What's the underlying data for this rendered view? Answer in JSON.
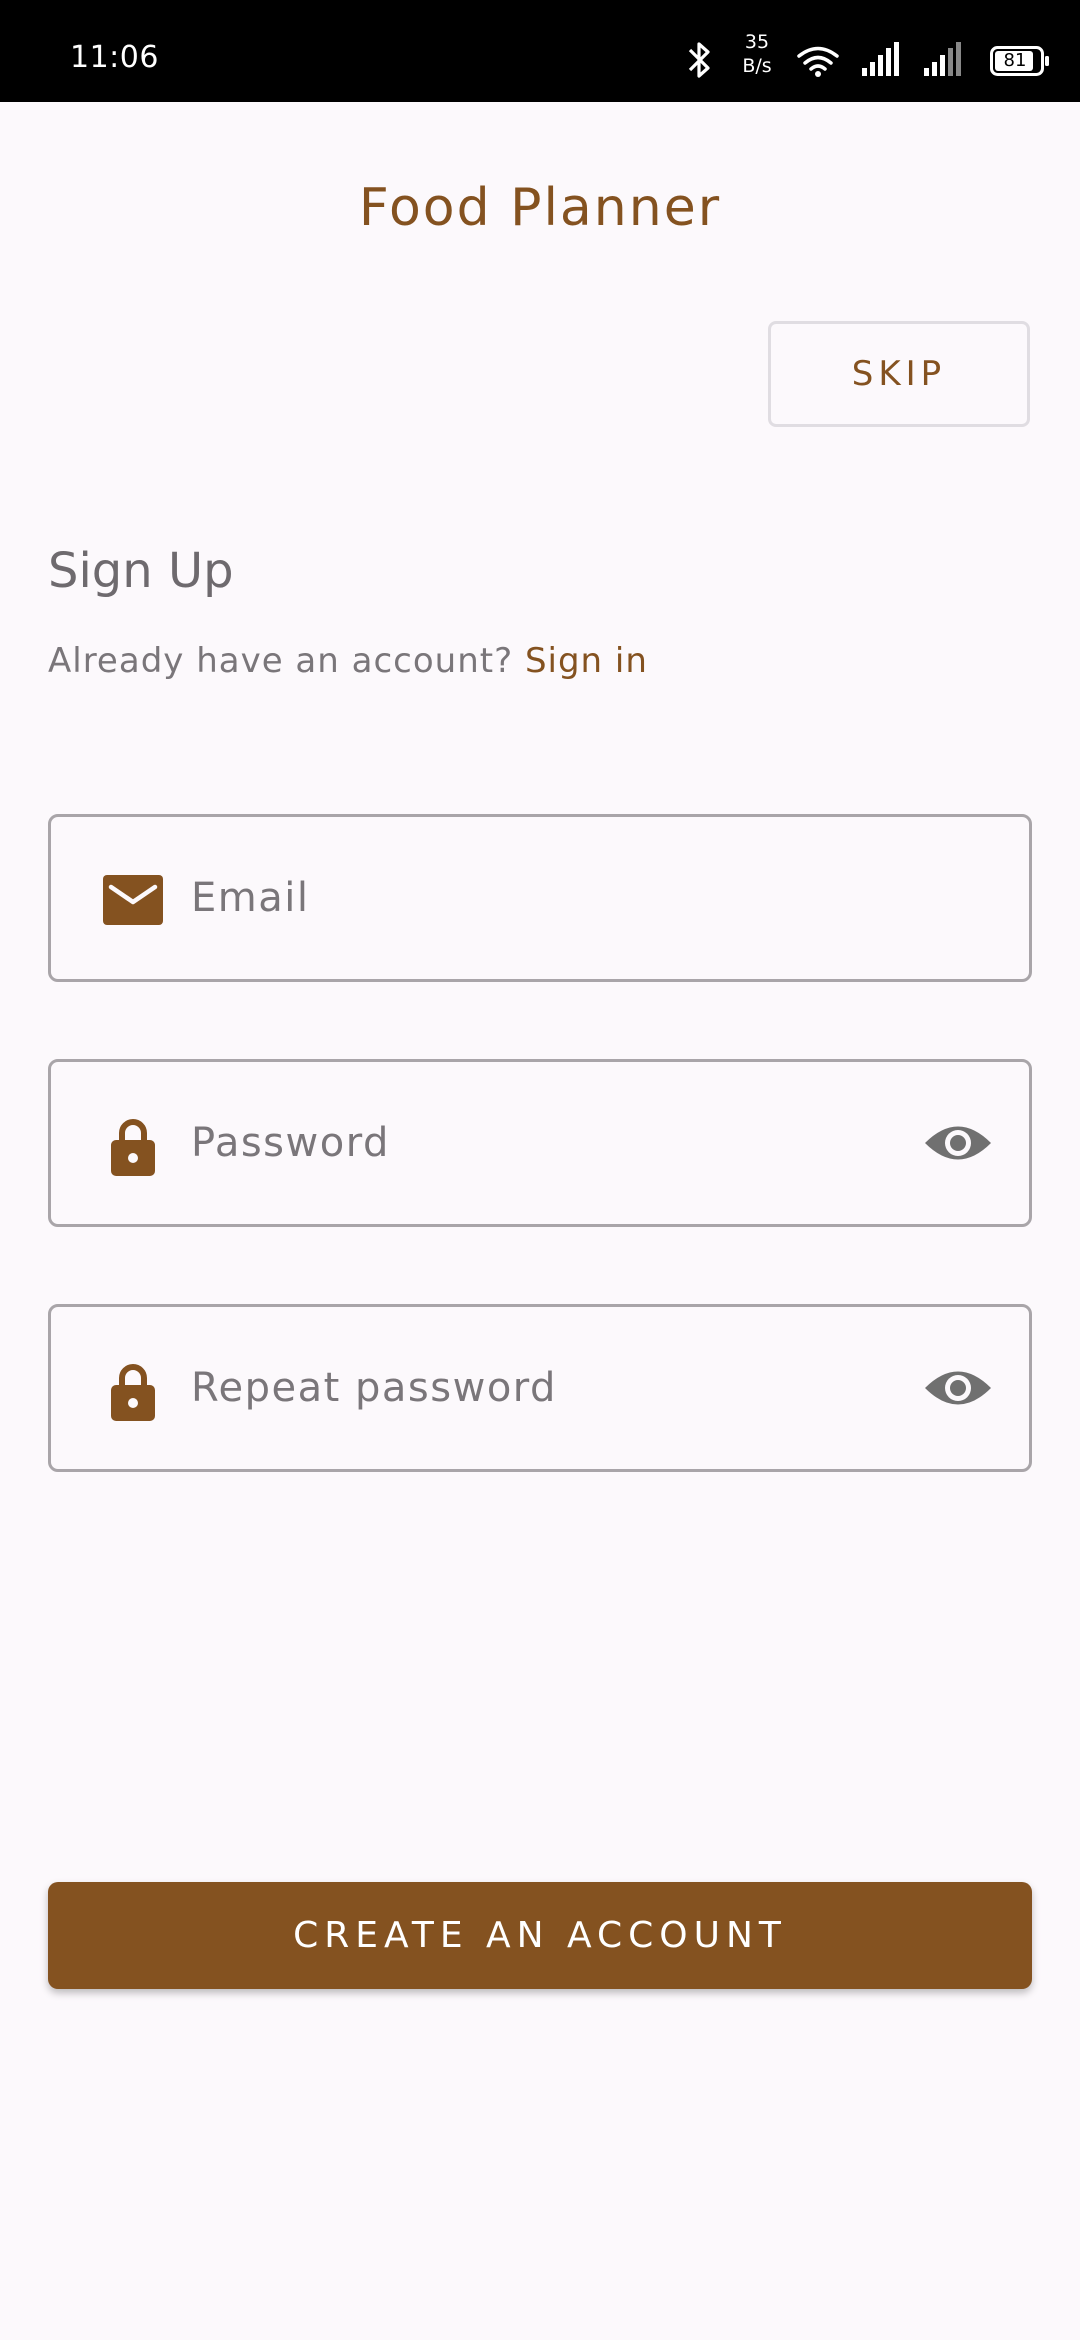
{
  "status_bar": {
    "time": "11:06",
    "net_speed_value": "35",
    "net_speed_unit": "B/s",
    "battery": "81",
    "icons": [
      "bluetooth-icon",
      "wifi-icon",
      "signal-icon",
      "signal-icon",
      "battery-icon"
    ]
  },
  "app": {
    "title": "Food Planner",
    "skip_label": "SKIP"
  },
  "form": {
    "heading": "Sign Up",
    "signin_prompt": "Already have an account?",
    "signin_link": "Sign in",
    "email_placeholder": "Email",
    "password_placeholder": "Password",
    "repeat_password_placeholder": "Repeat password",
    "submit_label": "CREATE AN ACCOUNT"
  },
  "colors": {
    "accent": "#845220",
    "background": "#fcf9fc",
    "border": "#a9a5a9",
    "text_muted": "#7a767a"
  }
}
